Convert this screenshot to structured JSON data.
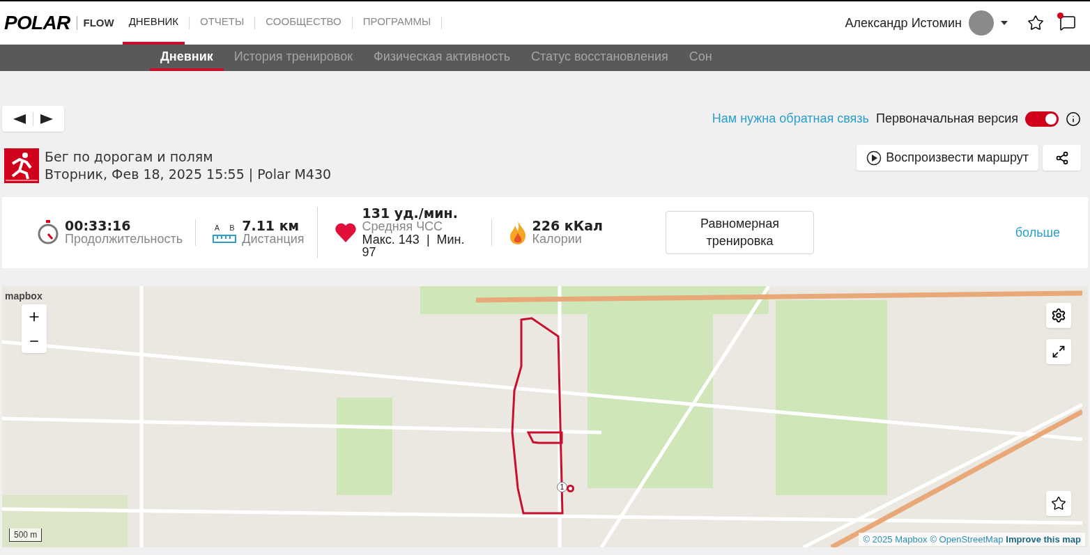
{
  "header": {
    "logo": "POLAR",
    "product": "FLOW",
    "nav": [
      {
        "label": "ДНЕВНИК",
        "selected": true
      },
      {
        "label": "ОТЧЕТЫ",
        "selected": false
      },
      {
        "label": "СООБЩЕСТВО",
        "selected": false
      },
      {
        "label": "ПРОГРАММЫ",
        "selected": false
      }
    ],
    "user": {
      "name": "Александр Истомин"
    },
    "notifications": {
      "unread": true
    }
  },
  "subnav": [
    {
      "label": "Дневник",
      "selected": true
    },
    {
      "label": "История тренировок",
      "selected": false
    },
    {
      "label": "Физическая активность",
      "selected": false
    },
    {
      "label": "Статус восстановления",
      "selected": false
    },
    {
      "label": "Сон",
      "selected": false
    }
  ],
  "toolbar": {
    "feedback_link": "Нам нужна обратная связь",
    "version_toggle": {
      "label": "Первоначальная версия",
      "on": true
    }
  },
  "activity": {
    "title": "Бег по дорогам и полям",
    "subtitle": "Вторник, Фев 18, 2025 15:55 | Polar M430",
    "play_button": "Воспроизвести маршрут"
  },
  "stats": [
    {
      "kind": "duration",
      "value": "00:33:16",
      "label": "Продолжительность"
    },
    {
      "kind": "distance",
      "value": "7.11 км",
      "label": "Дистанция",
      "a_label": "A",
      "b_label": "B"
    },
    {
      "kind": "heart_rate",
      "value": "131 уд./мин.",
      "label": "Средняя ЧСС",
      "detail": "Макс. 143  |  Мин. 97"
    },
    {
      "kind": "calories",
      "value": "226 кКал",
      "label": "Калории"
    }
  ],
  "training_type": "Равномерная тренировка",
  "more_link": "больше",
  "map": {
    "logo": "mapbox",
    "scale": "500 m",
    "route_marker": "1",
    "attribution": [
      "© 2025 Mapbox",
      "© OpenStreetMap",
      "Improve this map"
    ]
  }
}
